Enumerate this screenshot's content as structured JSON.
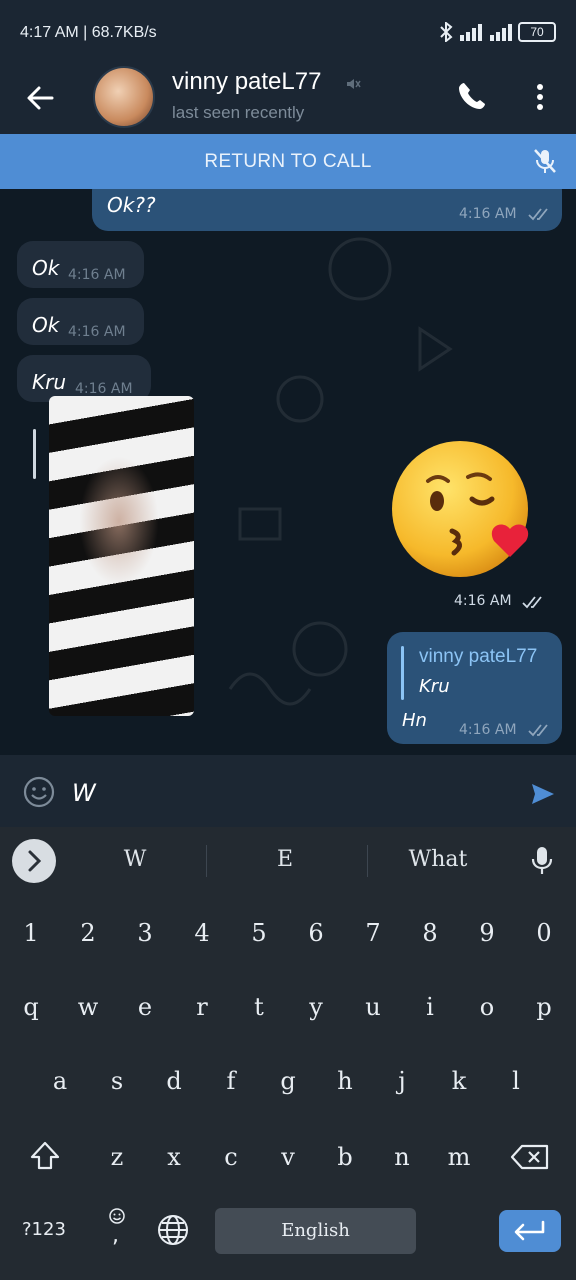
{
  "status_bar": {
    "left_text": "4:17 AM | 68.7KB/s",
    "battery": "70"
  },
  "header": {
    "contact_name": "vinny pateL77",
    "last_seen": "last seen recently",
    "icons": [
      "back-arrow-icon",
      "muted-icon",
      "phone-icon",
      "more-vert-icon"
    ]
  },
  "call_banner": {
    "label": "RETURN TO CALL",
    "icon": "mic-off-icon"
  },
  "messages": [
    {
      "direction": "out",
      "text": "Ok??",
      "time": "4:16 AM",
      "read": true
    },
    {
      "direction": "in",
      "text": "Ok",
      "time": "4:16 AM"
    },
    {
      "direction": "in",
      "text": "Ok",
      "time": "4:16 AM"
    },
    {
      "direction": "in",
      "text": "Kru",
      "time": "4:16 AM"
    },
    {
      "direction": "in",
      "type": "media"
    },
    {
      "direction": "out",
      "type": "emoji",
      "emoji": "😘",
      "time": "4:16 AM",
      "read": true
    },
    {
      "direction": "out",
      "reply_to": {
        "name": "vinny pateL77",
        "text": "Kru"
      },
      "text": "Hn",
      "time": "4:16 AM",
      "read": true
    }
  ],
  "composer": {
    "value": "W",
    "icons": [
      "emoji-icon",
      "send-icon"
    ]
  },
  "keyboard": {
    "suggestions": [
      "W",
      "E",
      "What"
    ],
    "number_row": [
      "1",
      "2",
      "3",
      "4",
      "5",
      "6",
      "7",
      "8",
      "9",
      "0"
    ],
    "row1": [
      "q",
      "w",
      "e",
      "r",
      "t",
      "y",
      "u",
      "i",
      "o",
      "p"
    ],
    "row2": [
      "a",
      "s",
      "d",
      "f",
      "g",
      "h",
      "j",
      "k",
      "l"
    ],
    "row3": [
      "z",
      "x",
      "c",
      "v",
      "b",
      "n",
      "m"
    ],
    "symbols_key": "?123",
    "comma_key": ",",
    "space_label": "English"
  },
  "colors": {
    "header_bg": "#1b2633",
    "banner_bg": "#4f8dd4",
    "out_bubble": "#2b5278",
    "in_bubble": "#212d3b",
    "keyboard_bg": "#232a31"
  }
}
